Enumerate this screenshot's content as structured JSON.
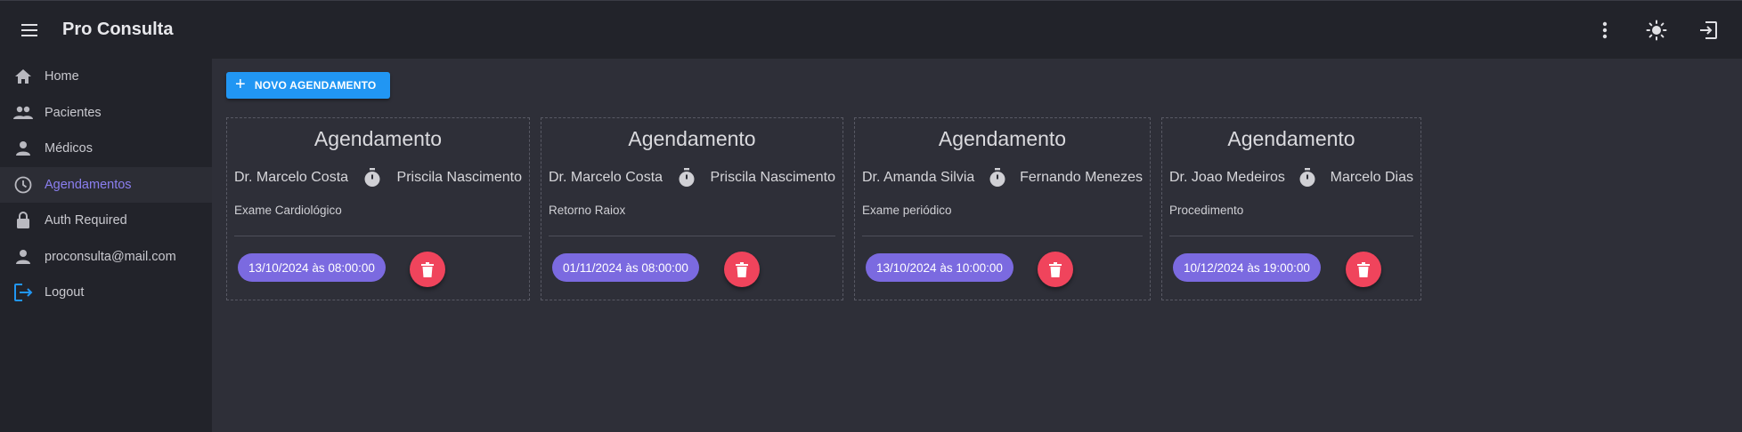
{
  "app": {
    "title": "Pro Consulta"
  },
  "sidebar": {
    "items": [
      {
        "label": "Home",
        "icon": "home-icon"
      },
      {
        "label": "Pacientes",
        "icon": "people-icon"
      },
      {
        "label": "Médicos",
        "icon": "doctor-icon"
      },
      {
        "label": "Agendamentos",
        "icon": "clock-icon",
        "active": true
      },
      {
        "label": "Auth Required",
        "icon": "lock-icon"
      },
      {
        "label": "proconsulta@mail.com",
        "icon": "person-icon"
      },
      {
        "label": "Logout",
        "icon": "logout-icon"
      }
    ]
  },
  "main": {
    "new_button_label": "NOVO AGENDAMENTO",
    "cards": [
      {
        "title": "Agendamento",
        "doctor": "Dr. Marcelo Costa",
        "patient": "Priscila Nascimento",
        "description": "Exame Cardiológico",
        "datetime": "13/10/2024 às 08:00:00"
      },
      {
        "title": "Agendamento",
        "doctor": "Dr. Marcelo Costa",
        "patient": "Priscila Nascimento",
        "description": "Retorno Raiox",
        "datetime": "01/11/2024 às 08:00:00"
      },
      {
        "title": "Agendamento",
        "doctor": "Dr. Amanda Silvia",
        "patient": "Fernando Menezes",
        "description": "Exame periódico",
        "datetime": "13/10/2024 às 10:00:00"
      },
      {
        "title": "Agendamento",
        "doctor": "Dr. Joao Medeiros",
        "patient": "Marcelo Dias",
        "description": "Procedimento",
        "datetime": "10/12/2024 às 19:00:00"
      }
    ]
  },
  "colors": {
    "accent": "#2196f3",
    "active_nav": "#8b7ff0",
    "chip": "#7b6ae0",
    "delete": "#f0445c"
  }
}
